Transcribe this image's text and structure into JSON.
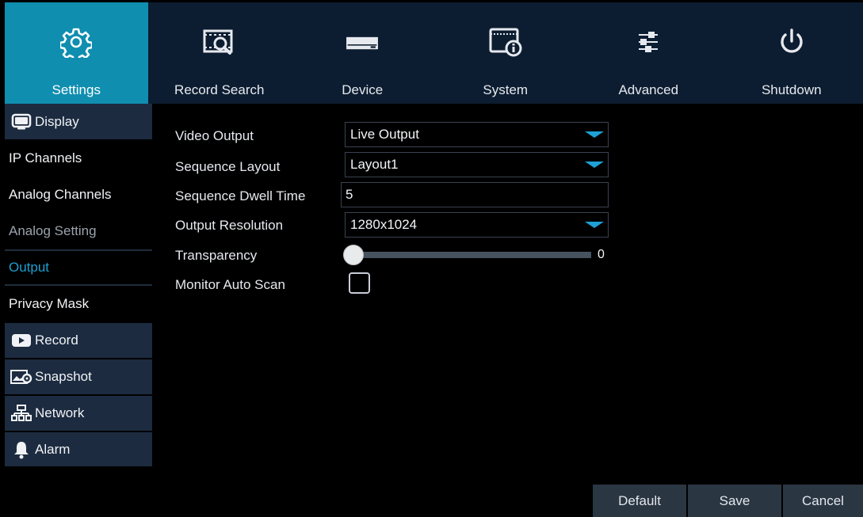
{
  "topnav": {
    "tabs": [
      {
        "label": "Settings",
        "icon": "gear-icon",
        "active": true
      },
      {
        "label": "Record Search",
        "icon": "record-search-icon",
        "active": false
      },
      {
        "label": "Device",
        "icon": "hard-drive-icon",
        "active": false
      },
      {
        "label": "System",
        "icon": "system-info-icon",
        "active": false
      },
      {
        "label": "Advanced",
        "icon": "sliders-icon",
        "active": false
      },
      {
        "label": "Shutdown",
        "icon": "power-icon",
        "active": false
      }
    ]
  },
  "sidebar": {
    "display_label": "Display",
    "ip_channels_label": "IP Channels",
    "analog_channels_label": "Analog Channels",
    "analog_setting_label": "Analog Setting",
    "output_label": "Output",
    "privacy_mask_label": "Privacy Mask",
    "record_label": "Record",
    "snapshot_label": "Snapshot",
    "network_label": "Network",
    "alarm_label": "Alarm"
  },
  "form": {
    "video_output": {
      "label": "Video Output",
      "value": "Live Output"
    },
    "sequence_layout": {
      "label": "Sequence Layout",
      "value": "Layout1"
    },
    "sequence_dwell_time": {
      "label": "Sequence Dwell Time",
      "value": "5"
    },
    "output_resolution": {
      "label": "Output Resolution",
      "value": "1280x1024"
    },
    "transparency": {
      "label": "Transparency",
      "value": "0",
      "level": 0
    },
    "monitor_auto_scan": {
      "label": "Monitor Auto Scan",
      "checked": false
    }
  },
  "footer": {
    "default_label": "Default",
    "save_label": "Save",
    "cancel_label": "Cancel"
  },
  "colors": {
    "accent": "#0f8eb0",
    "selected_text": "#1e9fd0",
    "dropdown_arrow": "#1da1d6",
    "category_bg": "#1c2b40",
    "button_bg": "#2b3643"
  }
}
